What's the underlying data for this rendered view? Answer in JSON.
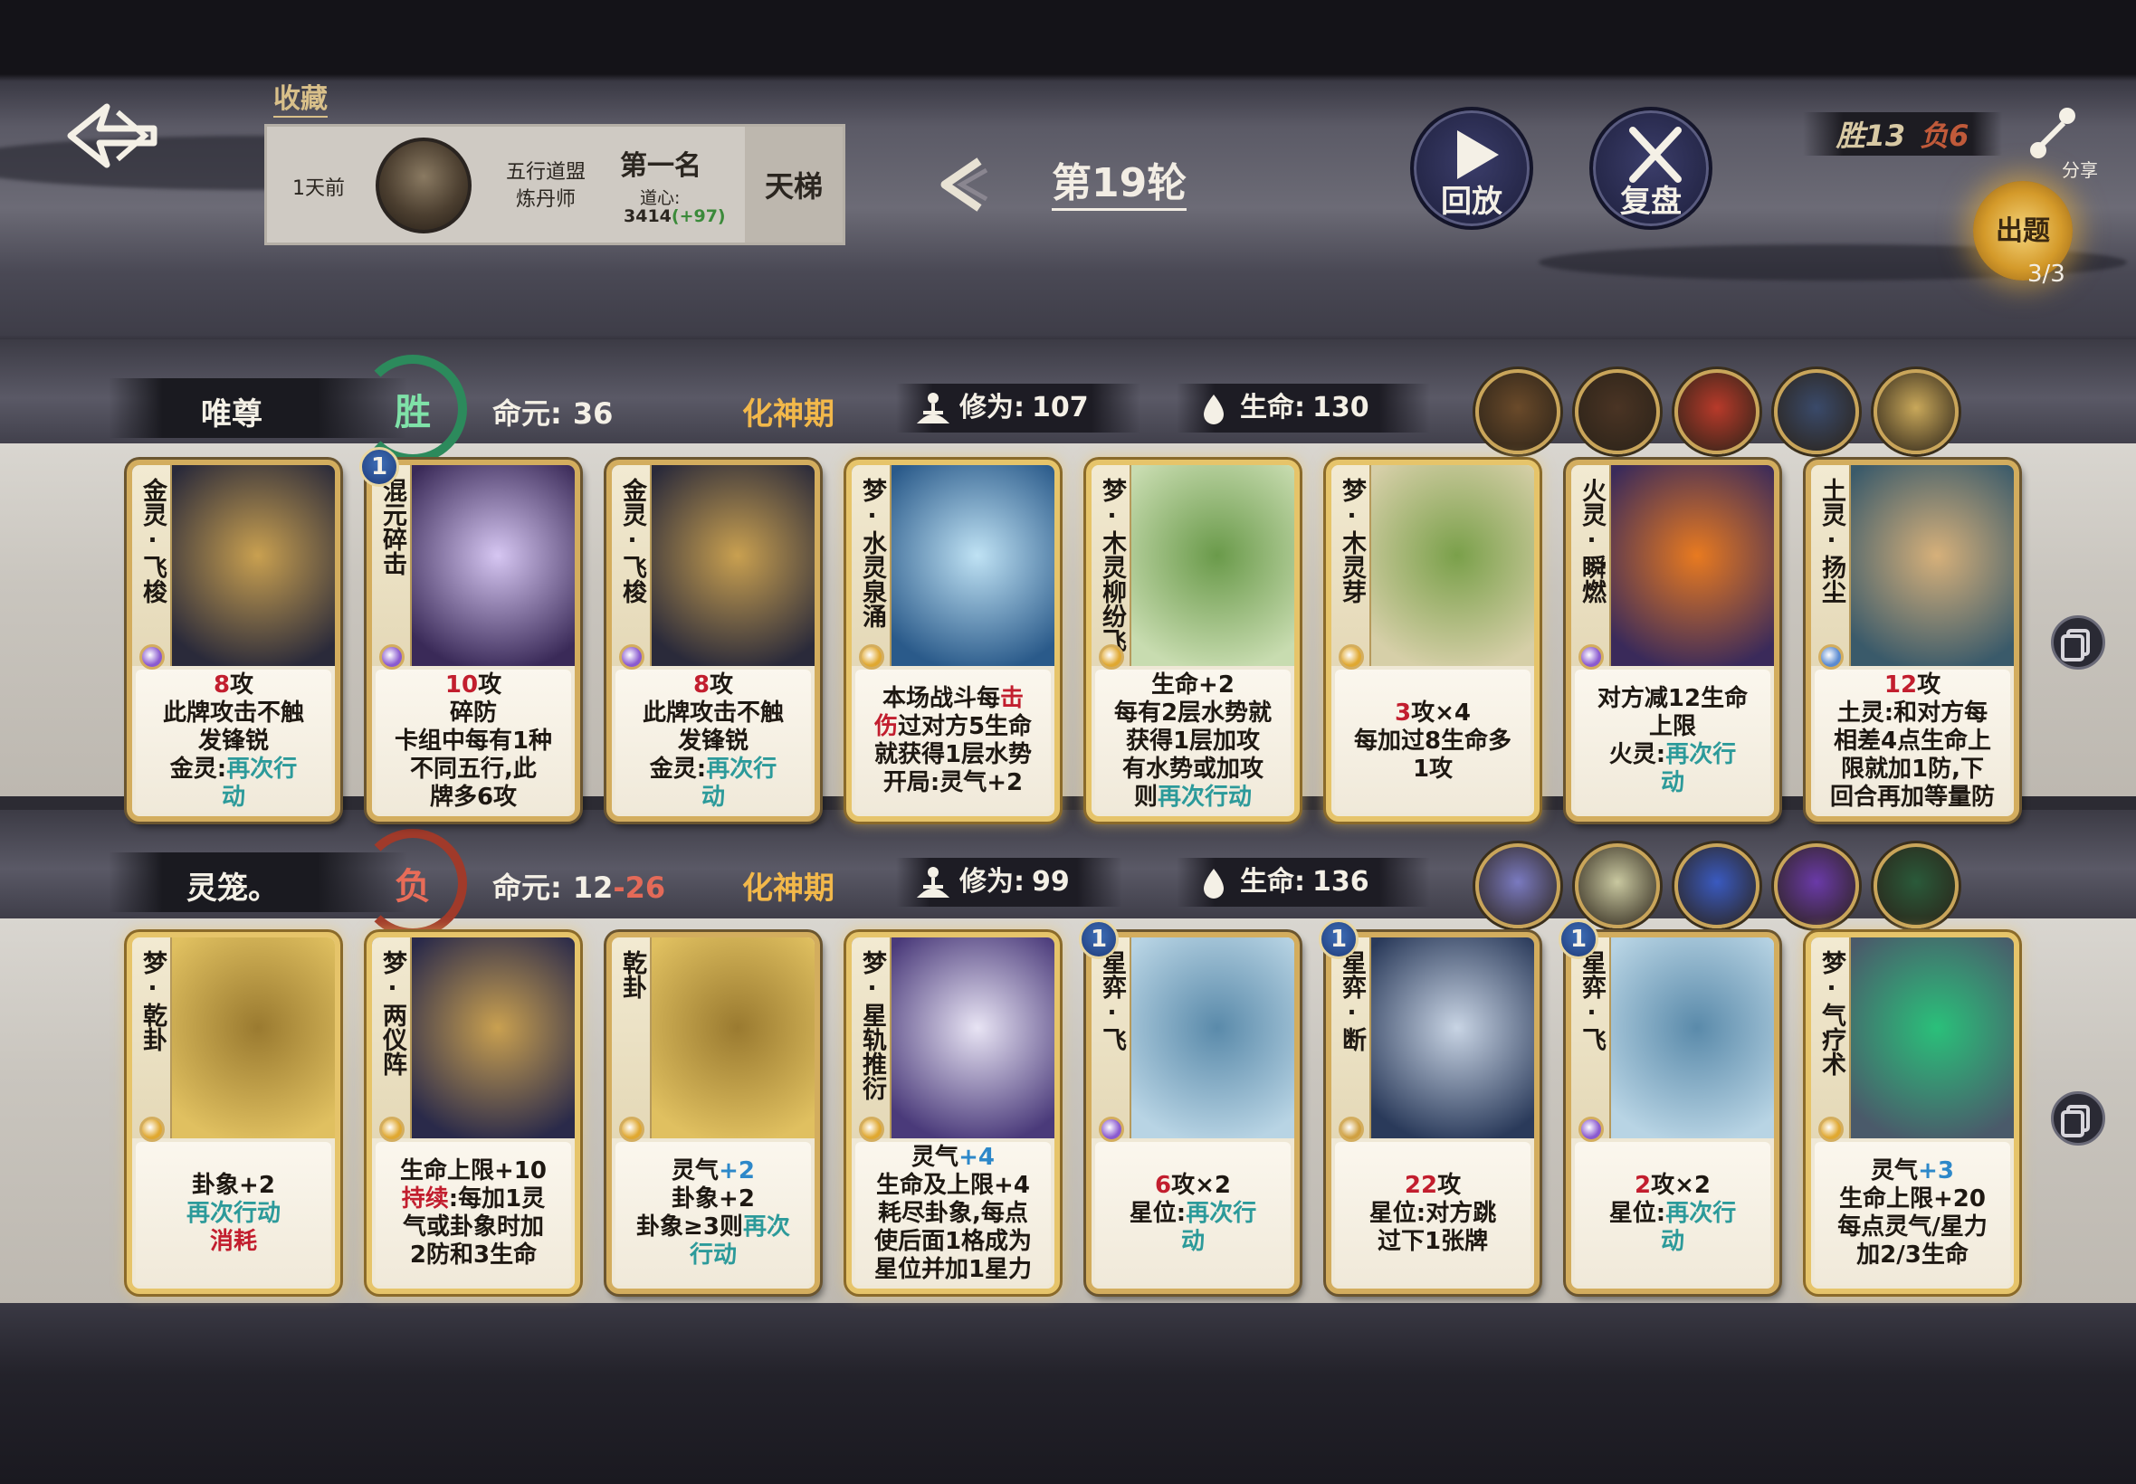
{
  "header": {
    "favorite_label": "收藏",
    "record": {
      "time_ago": "1天前",
      "sect_line1": "五行道盟",
      "sect_line2": "炼丹师",
      "rank": "第一名",
      "dao_label": "道心:",
      "score": "3414",
      "score_gain": "(+97)",
      "mode": "天梯"
    },
    "round_title": "第19轮",
    "replay_label": "回放",
    "review_label": "复盘",
    "wins": "胜13",
    "losses": "负6",
    "share_label": "分享",
    "question_label": "出题",
    "question_count": "3/3"
  },
  "players": [
    {
      "name": "唯尊",
      "result": "胜",
      "life_label": "命元:",
      "life_value": "36",
      "life_delta": "",
      "realm": "化神期",
      "cultivation_label": "修为:",
      "cultivation": "107",
      "hp_label": "生命:",
      "hp": "130",
      "relic_colors": [
        "#6a4a2a",
        "#4a3424",
        "#b83a2a",
        "#3a4a6a",
        "#c9a85a"
      ],
      "cards": [
        {
          "title": "金灵·飞梭",
          "dream": false,
          "level": "",
          "art": [
            "#2a2a3a",
            "#c9a050"
          ],
          "gem": "#8a5ad0",
          "desc": [
            {
              "t": "8",
              "c": "kw-red"
            },
            {
              "t": "攻\n此牌攻击不触\n发锋锐\n金灵:"
            },
            {
              "t": "再次行\n动",
              "c": "kw-teal"
            }
          ]
        },
        {
          "title": "混元碎击",
          "dream": false,
          "level": "1",
          "art": [
            "#3a2a58",
            "#d6c6f2"
          ],
          "gem": "#8a5ad0",
          "desc": [
            {
              "t": "10",
              "c": "kw-red"
            },
            {
              "t": "攻\n碎防\n卡组中每有1种\n不同五行,此\n牌多6攻"
            }
          ]
        },
        {
          "title": "金灵·飞梭",
          "dream": false,
          "level": "",
          "art": [
            "#2a2a3a",
            "#c9a050"
          ],
          "gem": "#8a5ad0",
          "desc": [
            {
              "t": "8",
              "c": "kw-red"
            },
            {
              "t": "攻\n此牌攻击不触\n发锋锐\n金灵:"
            },
            {
              "t": "再次行\n动",
              "c": "kw-teal"
            }
          ]
        },
        {
          "title": "梦·水灵泉涌",
          "dream": true,
          "level": "",
          "art": [
            "#2a5a8a",
            "#bfe2f4"
          ],
          "gem": "#e0a830",
          "desc": [
            {
              "t": "本场战斗每"
            },
            {
              "t": "击\n伤",
              "c": "kw-red"
            },
            {
              "t": "过对方5生命\n就获得1层水势\n开局:灵气+2"
            }
          ]
        },
        {
          "title": "梦·木灵柳纷飞",
          "dream": true,
          "level": "",
          "art": [
            "#c8dcb0",
            "#6a9a4a"
          ],
          "gem": "#e0a830",
          "desc": [
            {
              "t": "生命+2\n每有2层水势就\n获得1层加攻\n有水势或加攻\n则"
            },
            {
              "t": "再次行动",
              "c": "kw-teal"
            }
          ]
        },
        {
          "title": "梦·木灵芽",
          "dream": true,
          "level": "",
          "art": [
            "#d6cfa8",
            "#7aa04a"
          ],
          "gem": "#e0a830",
          "desc": [
            {
              "t": "3",
              "c": "kw-red"
            },
            {
              "t": "攻×4\n每加过8生命多\n1攻"
            }
          ]
        },
        {
          "title": "火灵·瞬燃",
          "dream": false,
          "level": "",
          "art": [
            "#3a2a5a",
            "#e87a20"
          ],
          "gem": "#8a5ad0",
          "desc": [
            {
              "t": "对方减12生命\n上限\n火灵:"
            },
            {
              "t": "再次行\n动",
              "c": "kw-teal"
            }
          ]
        },
        {
          "title": "土灵·扬尘",
          "dream": false,
          "level": "",
          "art": [
            "#3a5a6a",
            "#d6b07a"
          ],
          "gem": "#5a8ad0",
          "desc": [
            {
              "t": "12",
              "c": "kw-red"
            },
            {
              "t": "攻\n土灵:和对方每\n相差4点生命上\n限就加1防,下\n回合再加等量防"
            }
          ]
        }
      ]
    },
    {
      "name": "灵笼。",
      "result": "负",
      "life_label": "命元:",
      "life_value": "12",
      "life_delta": "-26",
      "realm": "化神期",
      "cultivation_label": "修为:",
      "cultivation": "99",
      "hp_label": "生命:",
      "hp": "136",
      "relic_colors": [
        "#7a7ac0",
        "#c9c8a0",
        "#3a5ac0",
        "#6a3aa8",
        "#2a5a3a"
      ],
      "cards": [
        {
          "title": "梦·乾卦",
          "dream": true,
          "level": "",
          "art": [
            "#e0c060",
            "#9a7a30"
          ],
          "gem": "#e0a830",
          "desc": [
            {
              "t": "卦象+2\n"
            },
            {
              "t": "再次行动",
              "c": "kw-teal"
            },
            {
              "t": "\n"
            },
            {
              "t": "消耗",
              "c": "kw-red"
            }
          ]
        },
        {
          "title": "梦·两仪阵",
          "dream": true,
          "level": "",
          "art": [
            "#2a2a4a",
            "#c9a050"
          ],
          "gem": "#e0a830",
          "desc": [
            {
              "t": "生命上限+10\n"
            },
            {
              "t": "持续",
              "c": "kw-red"
            },
            {
              "t": ":每加1灵\n气或卦象时加\n2防和3生命"
            }
          ]
        },
        {
          "title": "乾卦",
          "dream": false,
          "level": "",
          "art": [
            "#e0c060",
            "#9a7a30"
          ],
          "gem": "#e0a830",
          "desc": [
            {
              "t": "灵气"
            },
            {
              "t": "+2",
              "c": "kw-blue"
            },
            {
              "t": "\n卦象+2\n卦象≥3则"
            },
            {
              "t": "再次\n行动",
              "c": "kw-teal"
            }
          ]
        },
        {
          "title": "梦·星轨推衍",
          "dream": true,
          "level": "",
          "art": [
            "#4a3a7a",
            "#e8e4f4"
          ],
          "gem": "#e0a830",
          "desc": [
            {
              "t": "灵气"
            },
            {
              "t": "+4",
              "c": "kw-blue"
            },
            {
              "t": "\n生命及上限+4\n耗尽卦象,每点\n使后面1格成为\n星位并加1星力"
            }
          ]
        },
        {
          "title": "星弈·飞",
          "dream": false,
          "level": "1",
          "art": [
            "#b8d4e4",
            "#5a8aaa"
          ],
          "gem": "#8a5ad0",
          "desc": [
            {
              "t": "6",
              "c": "kw-red"
            },
            {
              "t": "攻×2\n星位:"
            },
            {
              "t": "再次行\n动",
              "c": "kw-teal"
            }
          ]
        },
        {
          "title": "星弈·断",
          "dream": false,
          "level": "1",
          "art": [
            "#2a3a5a",
            "#c8d4e4"
          ],
          "gem": "#d0a040",
          "desc": [
            {
              "t": "22",
              "c": "kw-red"
            },
            {
              "t": "攻\n星位:对方跳\n过下1张牌"
            }
          ]
        },
        {
          "title": "星弈·飞",
          "dream": false,
          "level": "1",
          "art": [
            "#b8d4e4",
            "#5a8aaa"
          ],
          "gem": "#8a5ad0",
          "desc": [
            {
              "t": "2",
              "c": "kw-red"
            },
            {
              "t": "攻×2\n星位:"
            },
            {
              "t": "再次行\n动",
              "c": "kw-teal"
            }
          ]
        },
        {
          "title": "梦·气疗术",
          "dream": true,
          "level": "",
          "art": [
            "#4a5a6a",
            "#2ac07a"
          ],
          "gem": "#e0a830",
          "desc": [
            {
              "t": "灵气"
            },
            {
              "t": "+3",
              "c": "kw-blue"
            },
            {
              "t": "\n生命上限+20\n每点灵气/星力\n加2/3生命"
            }
          ]
        }
      ]
    }
  ],
  "icons": {
    "back": "back-arrow-icon",
    "prev": "chevron-left-icon",
    "replay": "play-icon",
    "review": "crossed-swords-icon",
    "share": "share-icon",
    "cultivation": "meditation-icon",
    "hp": "heart-drop-icon",
    "side": "deck-view-icon"
  }
}
